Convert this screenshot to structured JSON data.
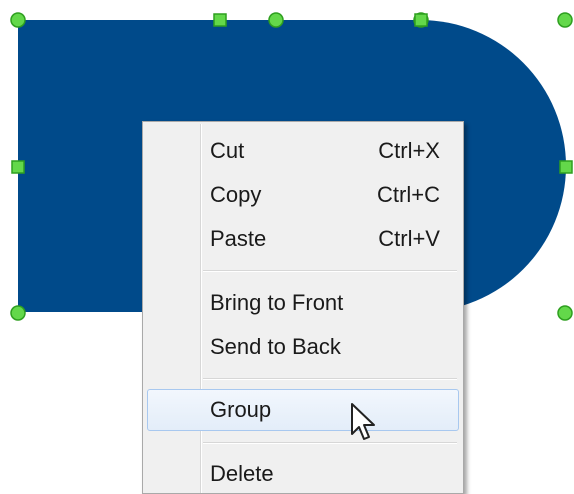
{
  "canvas": {
    "shape_fill": "#004a8a",
    "handle_fill": "#63d84a",
    "handle_stroke": "#2e9f1f"
  },
  "context_menu": {
    "items": [
      {
        "label": "Cut",
        "shortcut": "Ctrl+X"
      },
      {
        "label": "Copy",
        "shortcut": "Ctrl+C"
      },
      {
        "label": "Paste",
        "shortcut": "Ctrl+V"
      },
      {
        "label": "Bring to Front",
        "shortcut": ""
      },
      {
        "label": "Send to Back",
        "shortcut": ""
      },
      {
        "label": "Group",
        "shortcut": "",
        "highlighted": true
      },
      {
        "label": "Delete",
        "shortcut": ""
      }
    ]
  },
  "cursor_icon": "arrow-pointer-icon"
}
